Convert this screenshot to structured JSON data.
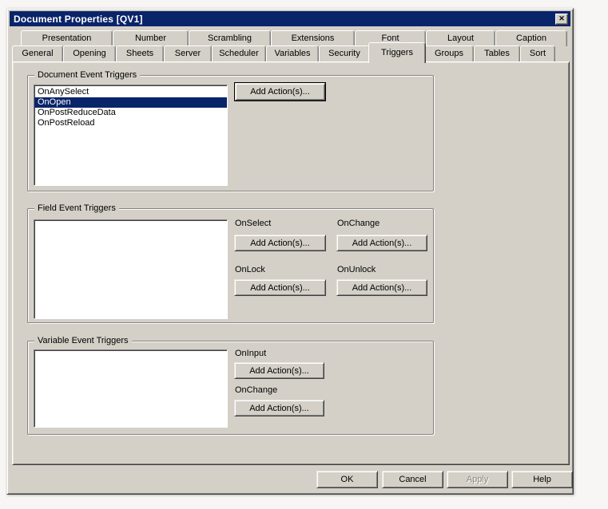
{
  "window": {
    "title": "Document Properties [QV1]",
    "close_icon": "✕"
  },
  "tabs": {
    "row1": [
      "Presentation",
      "Number",
      "Scrambling",
      "Extensions",
      "Font",
      "Layout",
      "Caption"
    ],
    "row2": [
      "General",
      "Opening",
      "Sheets",
      "Server",
      "Scheduler",
      "Variables",
      "Security",
      "Triggers",
      "Groups",
      "Tables",
      "Sort"
    ],
    "selected": "Triggers"
  },
  "document_triggers": {
    "group_label": "Document Event Triggers",
    "items": [
      "OnAnySelect",
      "OnOpen",
      "OnPostReduceData",
      "OnPostReload"
    ],
    "selected_item": "OnOpen",
    "add_action_label": "Add Action(s)..."
  },
  "field_triggers": {
    "group_label": "Field Event Triggers",
    "events": [
      "OnSelect",
      "OnChange",
      "OnLock",
      "OnUnlock"
    ],
    "add_action_label": "Add Action(s)..."
  },
  "variable_triggers": {
    "group_label": "Variable Event Triggers",
    "events": [
      "OnInput",
      "OnChange"
    ],
    "add_action_label": "Add Action(s)..."
  },
  "footer": {
    "ok": "OK",
    "cancel": "Cancel",
    "apply": "Apply",
    "help": "Help"
  },
  "colors": {
    "titlebar": "#0a246a",
    "selection_highlight": "#0a246a",
    "dialog_bg": "#d4d0c8"
  }
}
